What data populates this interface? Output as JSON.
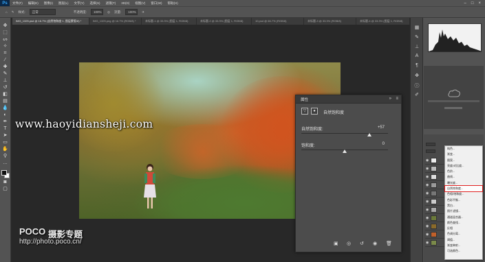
{
  "app": {
    "logo": "Ps"
  },
  "menubar": {
    "items": [
      "文件(F)",
      "编辑(E)",
      "图像(I)",
      "图层(L)",
      "文字(Y)",
      "选择(S)",
      "滤镜(T)",
      "3D(D)",
      "视图(V)",
      "窗口(W)",
      "帮助(H)"
    ],
    "window_buttons": [
      "–",
      "□",
      "×"
    ]
  },
  "options": {
    "sample_label": "样式:",
    "sample_value": "正常",
    "opacity_label": "不透明度:",
    "opacity_value": "100%",
    "flow_label": "流量:",
    "flow_value": "100%"
  },
  "tabs": [
    "IMG_1325.psd @ 16.7% (自然饱和度 1, 图层蒙版/8) *",
    "IMG_1325.png @ 16.7% (RGB/8) *",
    "未标题-1 @ 33.3% (图层 1, RGB/8)",
    "未标题-2 @ 33.3% (图层 1, RGB/8)",
    "10.psd @ 66.7% (RGB/8)",
    "未标题-3 @ 33.3% (RGB/8)",
    "未标题-4 @ 33.3% (图层 1, RGB/8)"
  ],
  "properties": {
    "panel_title": "属性",
    "adjustment_name": "自然饱和度",
    "vibrance_label": "自然饱和度:",
    "vibrance_value": "+57",
    "vibrance": 57,
    "saturation_label": "饱和度:",
    "saturation_value": "0",
    "saturation": 0,
    "range_min": -100,
    "range_max": 100
  },
  "context_menu": {
    "items": [
      "纯色...",
      "渐变...",
      "图案...",
      "亮度/对比度...",
      "色阶...",
      "曲线...",
      "曝光度...",
      "自然饱和度...",
      "色相/饱和度...",
      "色彩平衡...",
      "黑白...",
      "照片滤镜...",
      "通道混合器...",
      "颜色查找...",
      "反相",
      "色调分离...",
      "阈值...",
      "渐变映射...",
      "可选颜色..."
    ],
    "selected_index": 7
  },
  "watermark": {
    "site": "www.haoyidiansheji.com",
    "brand": "POCO",
    "brand_title": "摄影专题",
    "brand_url": "http://photo.poco.cn/"
  },
  "colors": {
    "ui_dark": "#535353",
    "workspace": "#282828",
    "highlight_border": "#e02020"
  }
}
